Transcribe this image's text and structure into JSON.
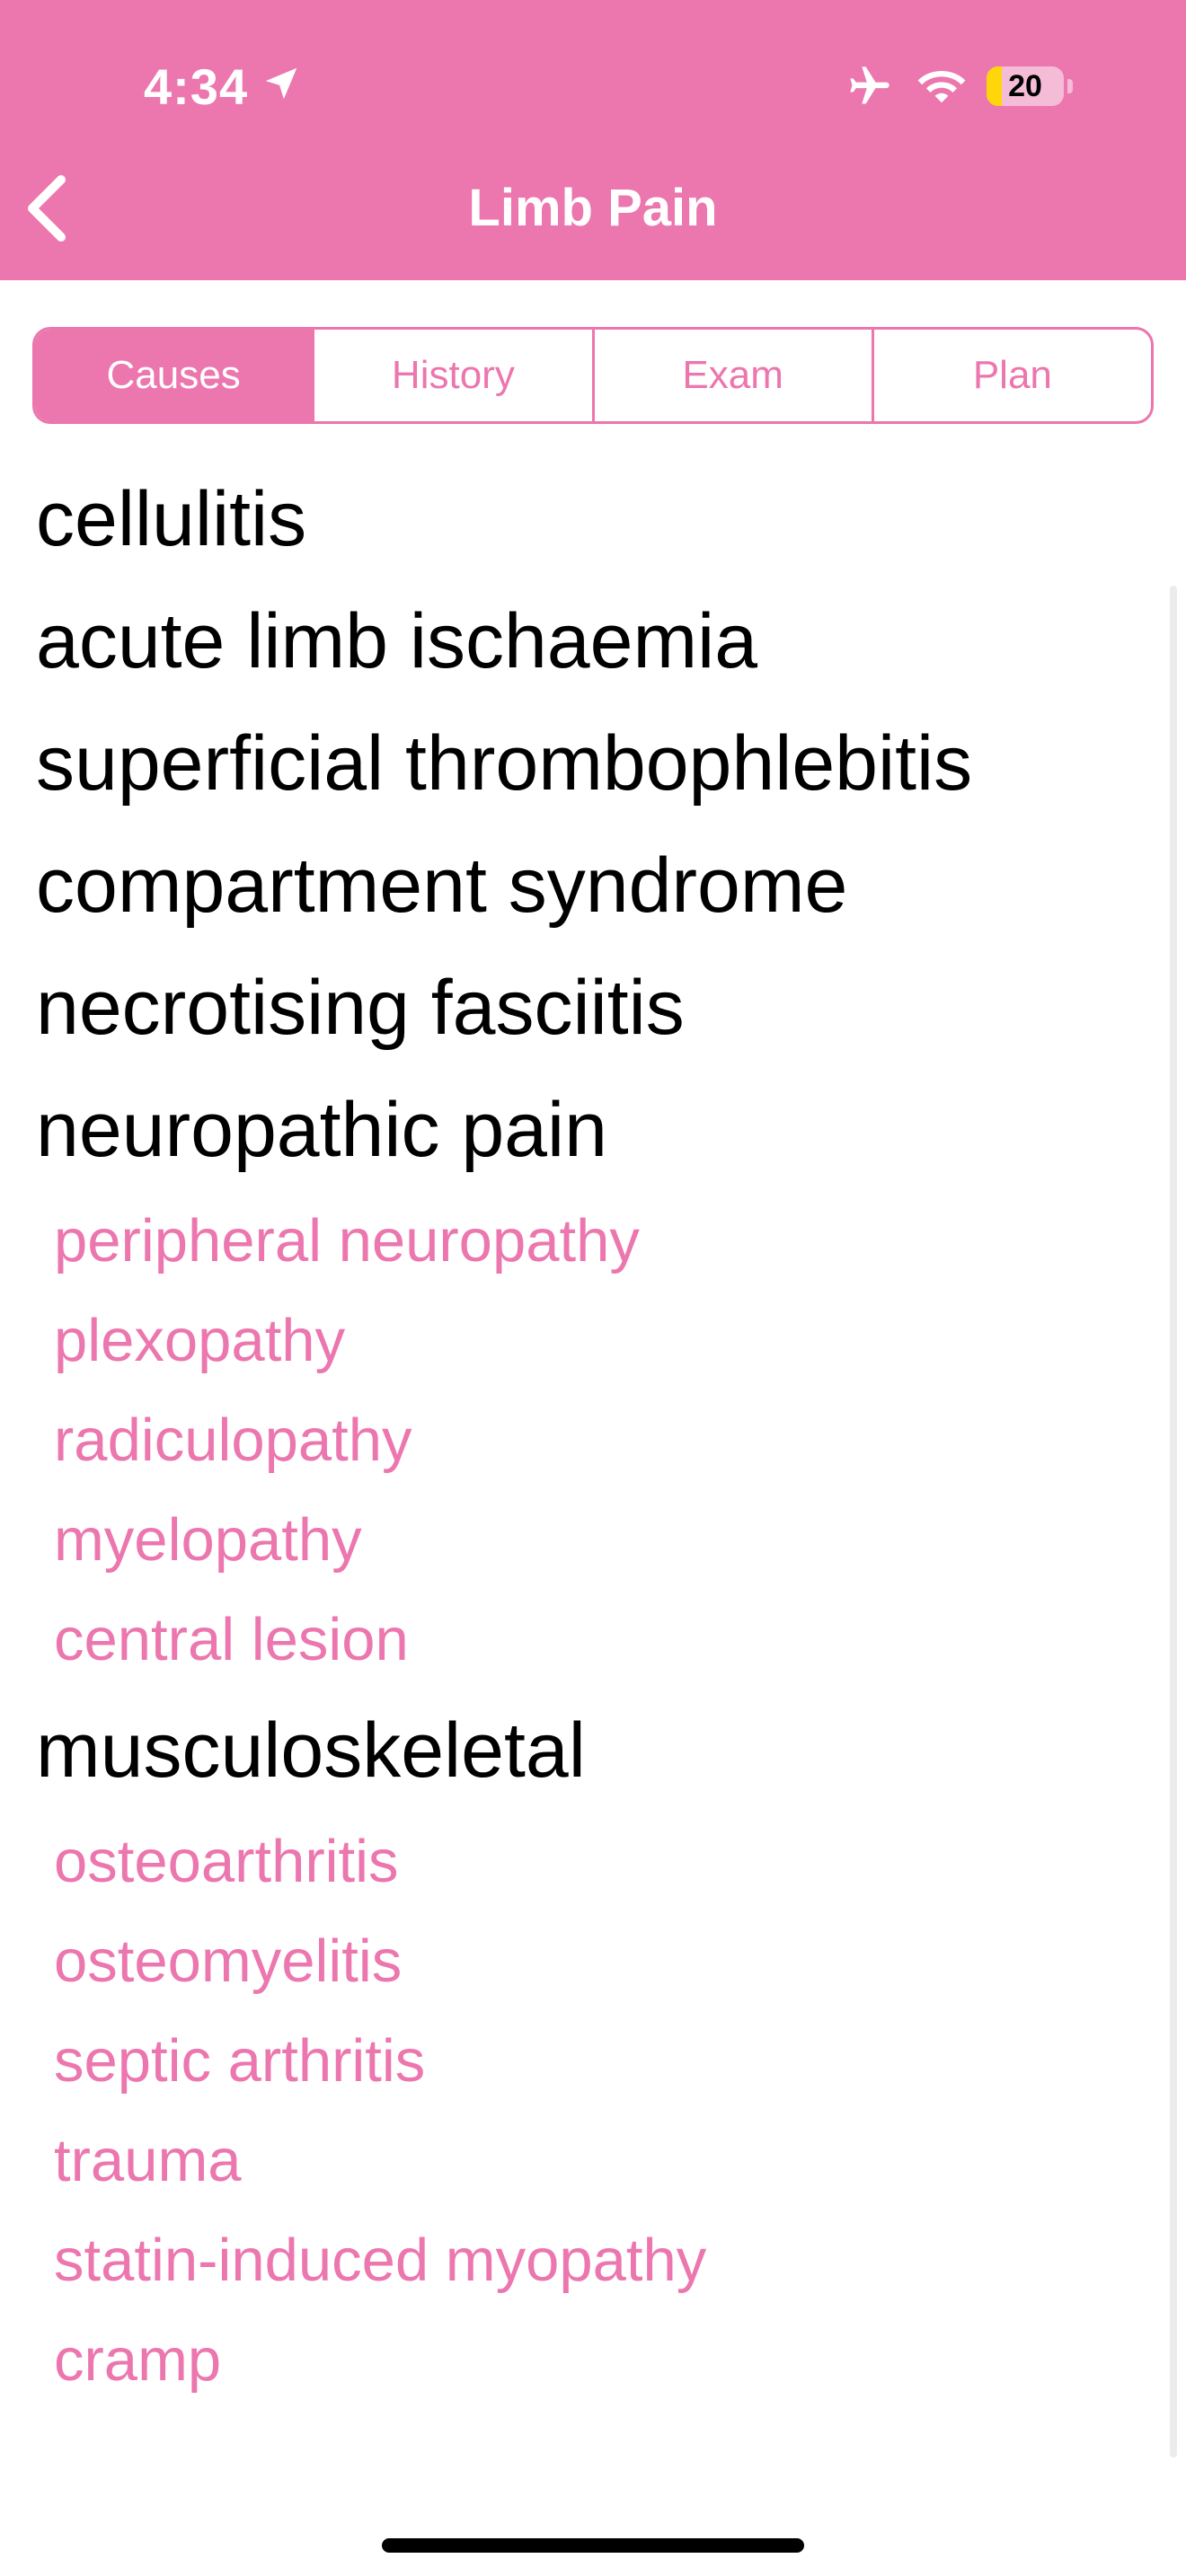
{
  "status_bar": {
    "time": "4:34",
    "battery_level": "20",
    "battery_fraction": 0.2,
    "icons": [
      "location-arrow-icon",
      "airplane-icon",
      "wifi-icon",
      "battery-icon"
    ]
  },
  "nav": {
    "title": "Limb Pain",
    "back_icon": "chevron-left-icon"
  },
  "tabs": [
    {
      "label": "Causes",
      "active": true
    },
    {
      "label": "History",
      "active": false
    },
    {
      "label": "Exam",
      "active": false
    },
    {
      "label": "Plan",
      "active": false
    }
  ],
  "causes": [
    {
      "label": "cellulitis",
      "level": "main"
    },
    {
      "label": "acute limb ischaemia",
      "level": "main"
    },
    {
      "label": "superficial thrombophlebitis",
      "level": "main"
    },
    {
      "label": "compartment syndrome",
      "level": "main"
    },
    {
      "label": "necrotising fasciitis",
      "level": "main"
    },
    {
      "label": "neuropathic pain",
      "level": "main"
    },
    {
      "label": "peripheral neuropathy",
      "level": "sub"
    },
    {
      "label": "plexopathy",
      "level": "sub"
    },
    {
      "label": "radiculopathy",
      "level": "sub"
    },
    {
      "label": "myelopathy",
      "level": "sub"
    },
    {
      "label": "central lesion",
      "level": "sub"
    },
    {
      "label": "musculoskeletal",
      "level": "main"
    },
    {
      "label": "osteoarthritis",
      "level": "sub"
    },
    {
      "label": "osteomyelitis",
      "level": "sub"
    },
    {
      "label": "septic arthritis",
      "level": "sub"
    },
    {
      "label": "trauma",
      "level": "sub"
    },
    {
      "label": "statin-induced myopathy",
      "level": "sub"
    },
    {
      "label": "cramp",
      "level": "sub"
    }
  ],
  "colors": {
    "accent": "#ec76ae",
    "text": "#000000",
    "background": "#ffffff",
    "battery_fill": "#ffd60a"
  }
}
